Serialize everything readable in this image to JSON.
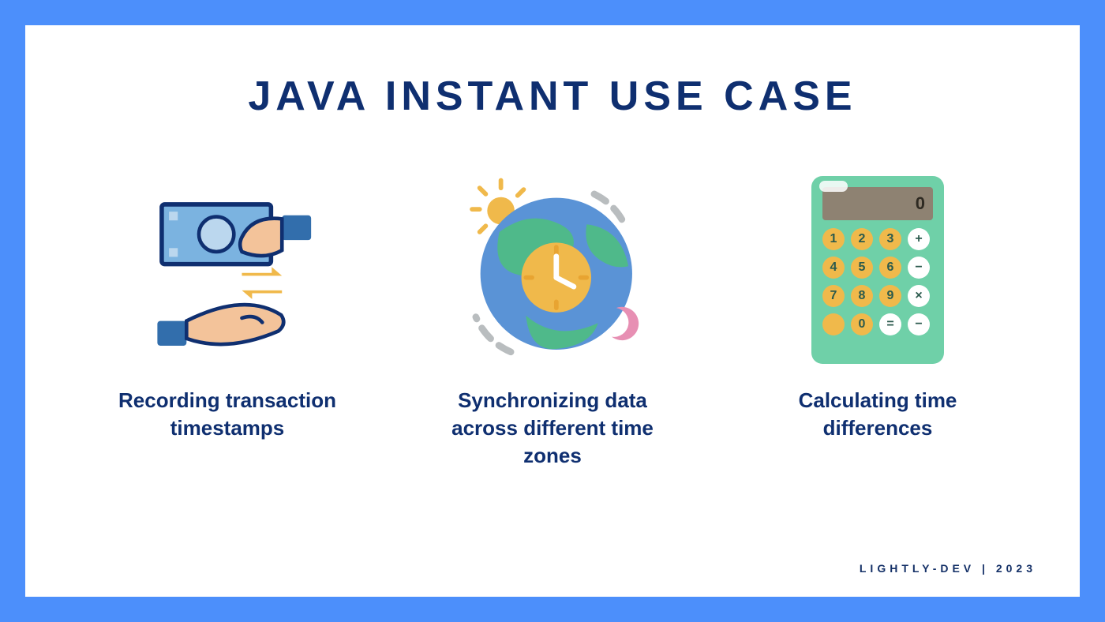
{
  "title": "JAVA INSTANT USE CASE",
  "items": [
    {
      "caption": "Recording transaction timestamps",
      "icon": "money-exchange-icon"
    },
    {
      "caption": "Synchronizing data across different time zones",
      "icon": "globe-clock-icon"
    },
    {
      "caption": "Calculating time differences",
      "icon": "calculator-icon"
    }
  ],
  "footer": "LIGHTLY-DEV | 2023",
  "colors": {
    "frame": "#4C8FFB",
    "text_primary": "#0F2F70",
    "accent_green": "#5FCBA5",
    "accent_yellow": "#F0B94B",
    "accent_blue": "#7BB3E0"
  },
  "calculator": {
    "display": "0",
    "keys": [
      [
        "1",
        "num"
      ],
      [
        "2",
        "num"
      ],
      [
        "3",
        "num"
      ],
      [
        "+",
        "op"
      ],
      [
        "4",
        "num"
      ],
      [
        "5",
        "num"
      ],
      [
        "6",
        "num"
      ],
      [
        "−",
        "op"
      ],
      [
        "7",
        "num"
      ],
      [
        "8",
        "num"
      ],
      [
        "9",
        "num"
      ],
      [
        "×",
        "op"
      ],
      [
        "",
        "num"
      ],
      [
        "0",
        "num"
      ],
      [
        "=",
        "op"
      ],
      [
        "−",
        "op"
      ]
    ]
  }
}
